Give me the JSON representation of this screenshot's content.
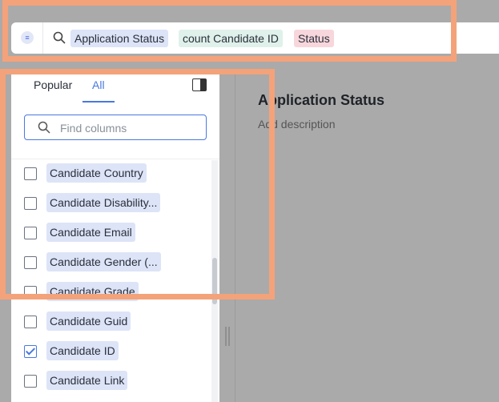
{
  "query_bar": {
    "menu_glyph": "≡",
    "chips": [
      {
        "label": "Application Status",
        "color": "#dde4f7"
      },
      {
        "label": "count Candidate ID",
        "color": "#dff1ea"
      },
      {
        "label": "Status",
        "color": "#f8d7dc"
      }
    ]
  },
  "panel": {
    "tabs": [
      {
        "label": "Popular"
      },
      {
        "label": "All"
      }
    ],
    "search": {
      "placeholder": "Find columns"
    },
    "items": [
      {
        "label": "Candidate Country",
        "checked": false
      },
      {
        "label": "Candidate Disability...",
        "checked": false
      },
      {
        "label": "Candidate Email",
        "checked": false
      },
      {
        "label": "Candidate Gender (...",
        "checked": false
      },
      {
        "label": "Candidate Grade",
        "checked": false
      },
      {
        "label": "Candidate Guid",
        "checked": false
      },
      {
        "label": "Candidate ID",
        "checked": true
      },
      {
        "label": "Candidate Link",
        "checked": false
      }
    ]
  },
  "main": {
    "title": "Application Status",
    "description_placeholder": "Add description"
  },
  "colors": {
    "accent": "#4a78e0",
    "highlight": "#f4a27a"
  }
}
